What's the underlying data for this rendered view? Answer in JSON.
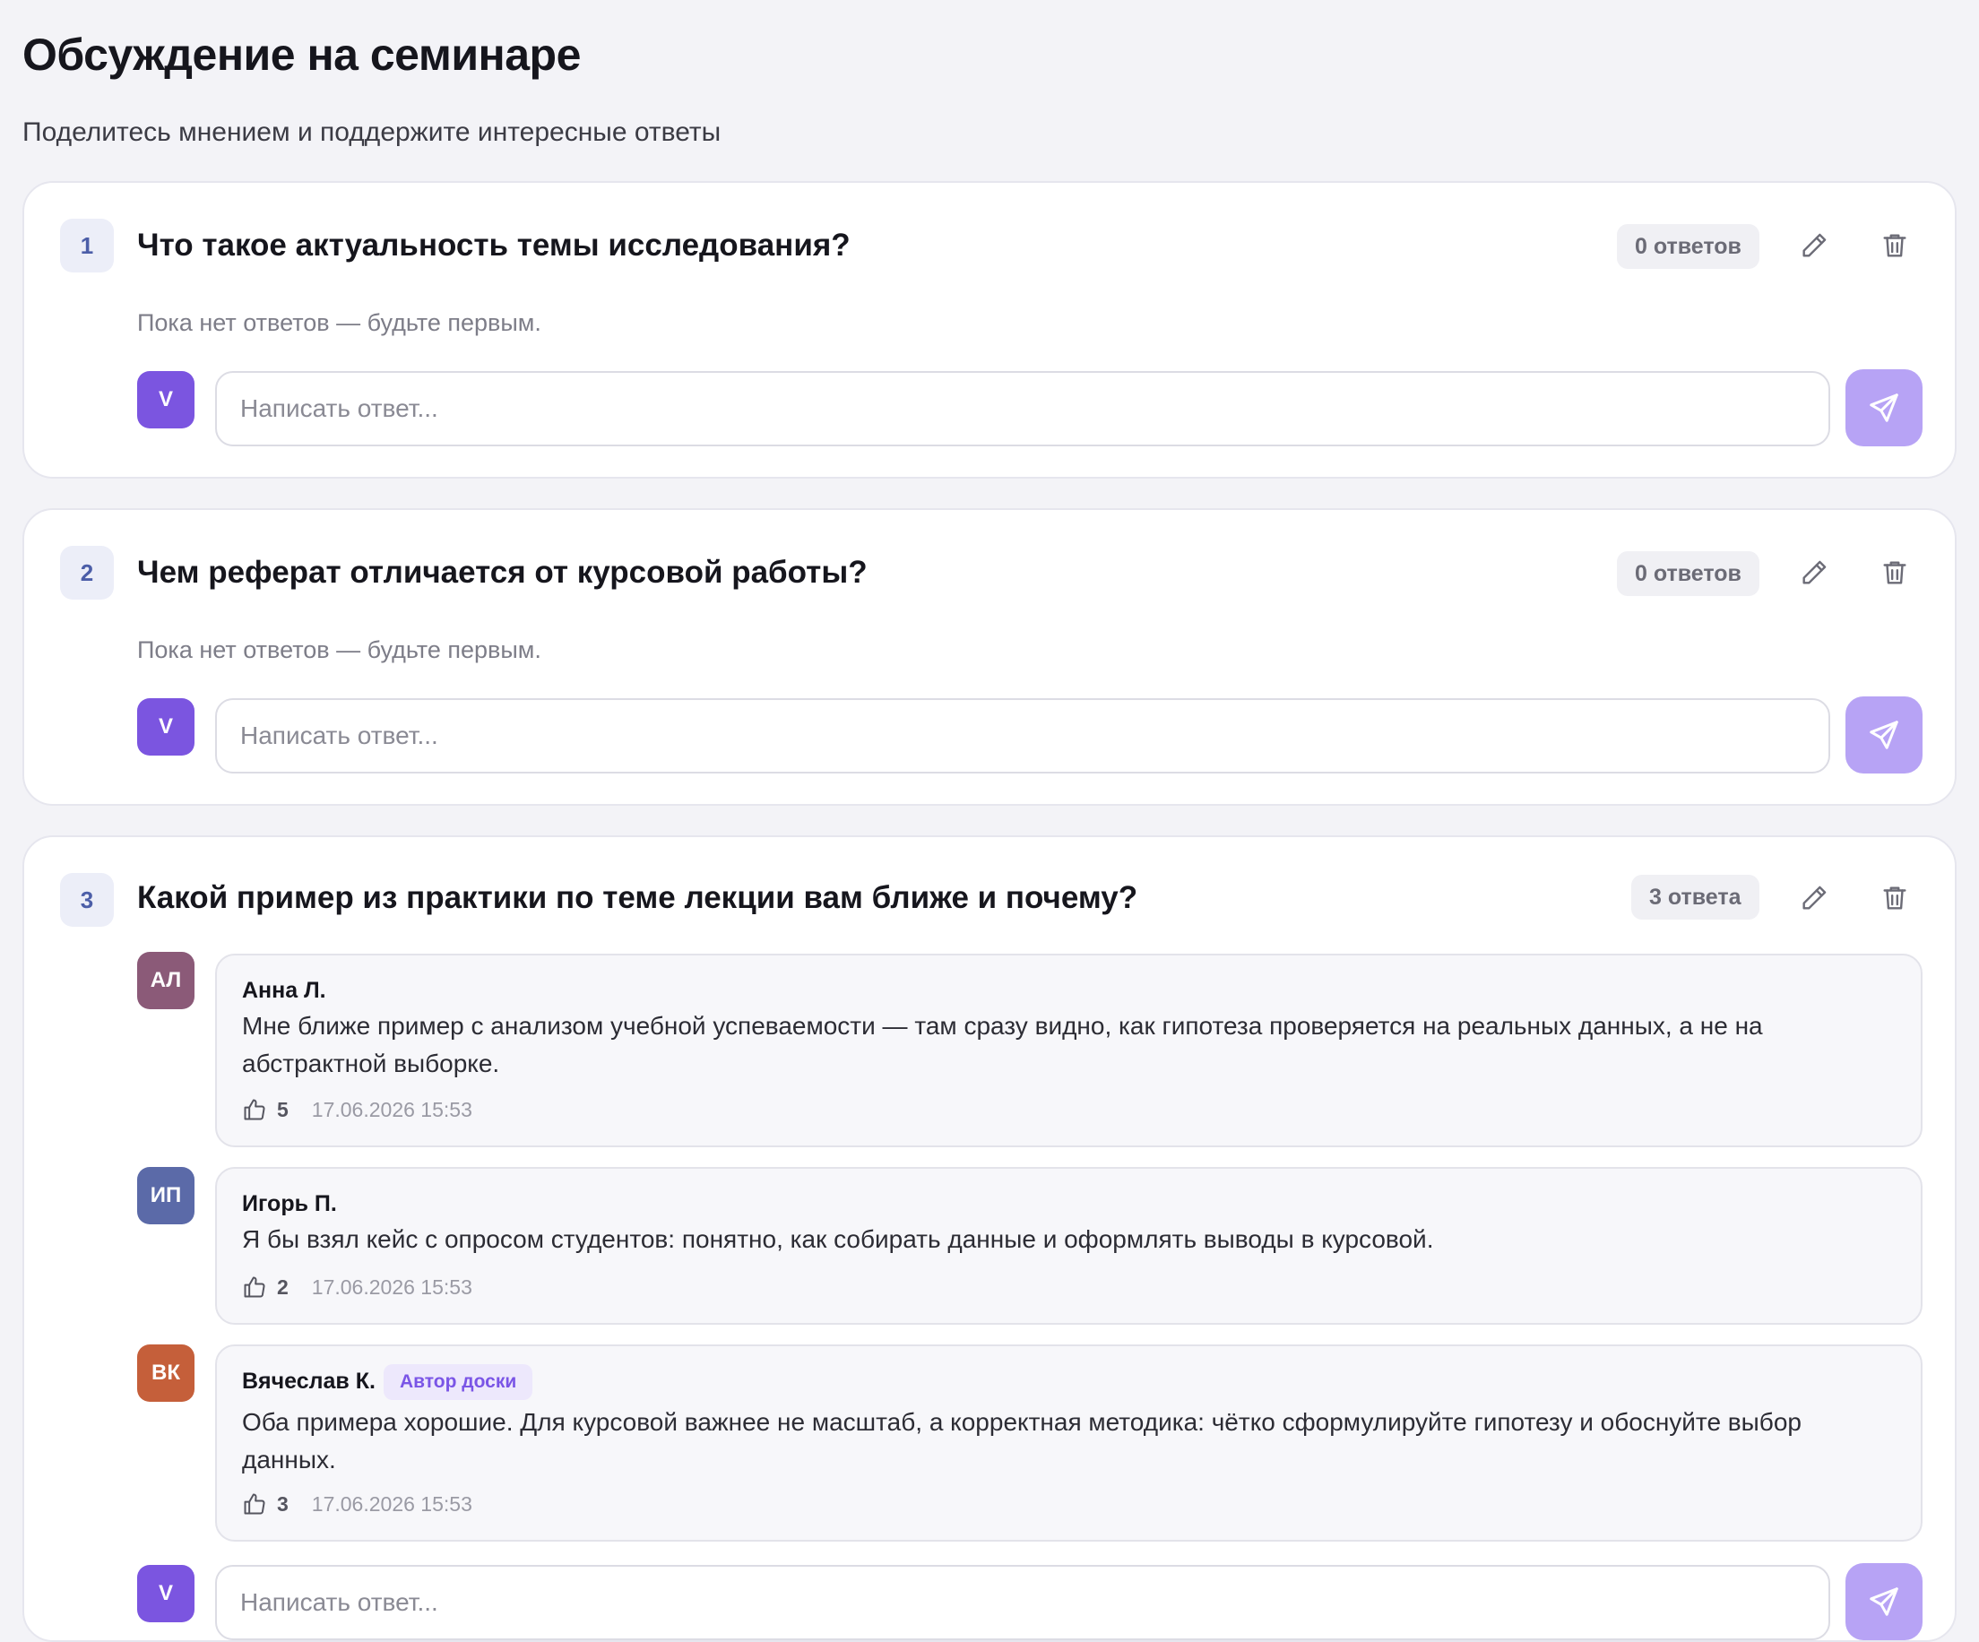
{
  "header": {
    "title": "Обсуждение на семинаре",
    "subtitle": "Поделитесь мнением и поддержите интересные ответы"
  },
  "composer": {
    "placeholder": "Написать ответ...",
    "user_initial": "V"
  },
  "questions": [
    {
      "number": "1",
      "title": "Что такое актуальность темы исследования?",
      "count_label": "0 ответов",
      "empty_text": "Пока нет ответов — будьте первым."
    },
    {
      "number": "2",
      "title": "Чем реферат отличается от курсовой работы?",
      "count_label": "0 ответов",
      "empty_text": "Пока нет ответов — будьте первым."
    },
    {
      "number": "3",
      "title": "Какой пример из практики по теме лекции вам ближе и почему?",
      "count_label": "3 ответа",
      "answers": [
        {
          "initials": "АЛ",
          "avatar_color": "#8b5a78",
          "author": "Анна Л.",
          "text": "Мне ближе пример с анализом учебной успеваемости — там сразу видно, как гипотеза проверяется на реальных данных, а не на абстрактной выборке.",
          "likes": "5",
          "timestamp": "17.06.2026 15:53"
        },
        {
          "initials": "ИП",
          "avatar_color": "#5b6aa8",
          "author": "Игорь П.",
          "text": "Я бы взял кейс с опросом студентов: понятно, как собирать данные и оформлять выводы в курсовой.",
          "likes": "2",
          "timestamp": "17.06.2026 15:53"
        },
        {
          "initials": "ВК",
          "avatar_color": "#c55f3a",
          "author": "Вячеслав К.",
          "badge": "Автор доски",
          "text": "Оба примера хорошие. Для курсовой важнее не масштаб, а корректная методика: чётко сформулируйте гипотезу и обоснуйте выбор данных.",
          "likes": "3",
          "timestamp": "17.06.2026 15:53"
        }
      ]
    }
  ],
  "colors": {
    "accent": "#7b55e0",
    "send_button": "#b7a3f5",
    "background": "#f3f3f7"
  },
  "icons": {
    "edit": "pencil-icon",
    "delete": "trash-icon",
    "send": "send-icon",
    "like": "thumbs-up-icon"
  }
}
